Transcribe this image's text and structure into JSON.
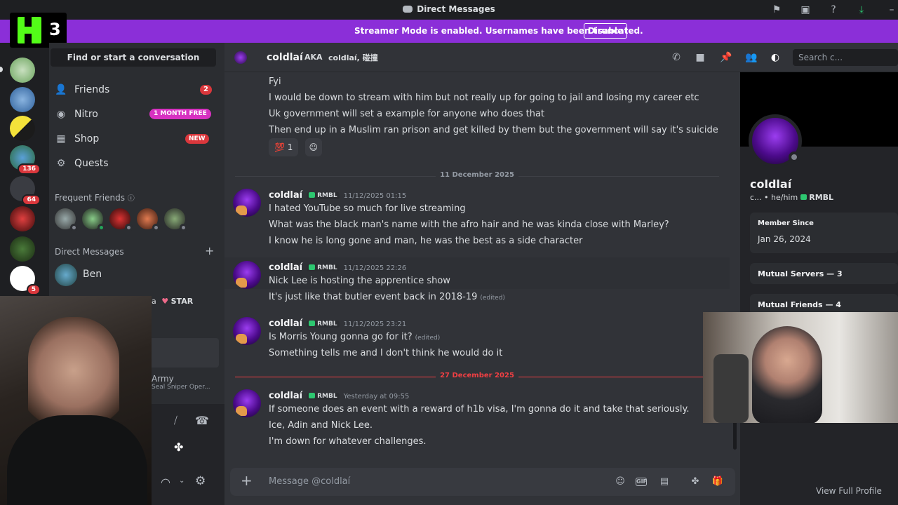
{
  "titlebar": {
    "title": "Direct Messages"
  },
  "banner": {
    "text": "Streamer Mode is enabled. Usernames have been truncated.",
    "button": "Disable"
  },
  "overlay_logo": {
    "letter": "K",
    "number": "3"
  },
  "rail": {
    "badges": [
      "136",
      "64",
      "5"
    ]
  },
  "sidebar": {
    "find": "Find or start a conversation",
    "nav": [
      {
        "label": "Friends",
        "badge": "2"
      },
      {
        "label": "Nitro",
        "badge": "1 MONTH FREE"
      },
      {
        "label": "Shop",
        "badge": "NEW"
      },
      {
        "label": "Quests"
      }
    ],
    "frequent_friends": "Frequent Friends",
    "direct_messages": "Direct Messages",
    "add": "+",
    "dm_items": [
      {
        "name": "Ben"
      },
      {
        "name": "a",
        "tag": "STAR"
      },
      {
        "name": "Army",
        "sub": "Seal Sniper Oper..."
      }
    ]
  },
  "chat": {
    "header": {
      "name": "coldlaí",
      "aka": "AKA",
      "aka_values": "coldlaí, 碰撞",
      "search": "Search c..."
    },
    "block0": {
      "lines": [
        "Fyi",
        "I would be down to stream with him but not really up for going to jail and losing my career etc",
        "Uk government will set a example for anyone who does that",
        "Then end up in a Muslim ran prison and get killed by them but the government will say it's suicide"
      ],
      "reaction": {
        "emoji": "💯",
        "count": "1"
      }
    },
    "divider1": "11 December 2025",
    "messages": [
      {
        "author": "coldlaí",
        "tag": "RMBL",
        "time": "11/12/2025 01:15",
        "lines": [
          "I hated YouTube so much for live streaming",
          "What was the black man's name with the afro hair and he was kinda close with Marley?",
          "I know he is long gone and man, he was the best as a side character"
        ]
      },
      {
        "author": "coldlaí",
        "tag": "RMBL",
        "time": "11/12/2025 22:26",
        "lines": [
          "Nick Lee is hosting the apprentice show",
          "It's just like that butler event back in 2018-19"
        ],
        "edited": "(edited)"
      },
      {
        "author": "coldlaí",
        "tag": "RMBL",
        "time": "11/12/2025 23:21",
        "lines": [
          "Is Morris Young gonna go for it?",
          "Something tells me and I don't think he would do it"
        ],
        "edited": "(edited)"
      }
    ],
    "divider2": "27 December 2025",
    "last": {
      "author": "coldlaí",
      "tag": "RMBL",
      "time": "Yesterday at 09:55",
      "lines": [
        "If someone does an event with a reward of h1b visa, I'm gonna do it and take that seriously.",
        "Ice, Adin and Nick Lee.",
        "I'm down for whatever challenges."
      ]
    },
    "composer": {
      "placeholder": "Message @coldlaí",
      "gif": "GIF"
    }
  },
  "profile": {
    "name": "coldlaí",
    "sub": "c... • he/him",
    "tag": "RMBL",
    "member_since_label": "Member Since",
    "member_since": "Jan 26, 2024",
    "mutual_servers": "Mutual Servers — 3",
    "mutual_friends": "Mutual Friends — 4",
    "view_full": "View Full Profile"
  },
  "colors": {
    "banner": "#8b2fd8",
    "accent_green": "#53fc18",
    "danger": "#f23f43"
  }
}
